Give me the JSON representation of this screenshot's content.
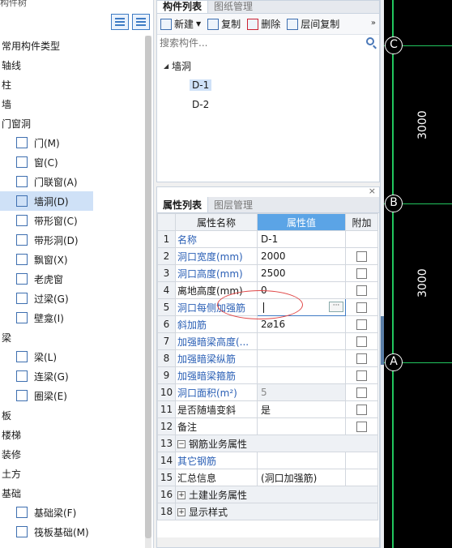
{
  "left_panel": {
    "title": "构件树",
    "tree": [
      {
        "label": "常用构件类型",
        "type": "cat"
      },
      {
        "label": "轴线",
        "type": "cat"
      },
      {
        "label": "柱",
        "type": "cat"
      },
      {
        "label": "墙",
        "type": "cat"
      },
      {
        "label": "门窗洞",
        "type": "cat"
      },
      {
        "label": "门(M)",
        "type": "leaf"
      },
      {
        "label": "窗(C)",
        "type": "leaf"
      },
      {
        "label": "门联窗(A)",
        "type": "leaf"
      },
      {
        "label": "墙洞(D)",
        "type": "leaf",
        "selected": true
      },
      {
        "label": "带形窗(C)",
        "type": "leaf"
      },
      {
        "label": "带形洞(D)",
        "type": "leaf"
      },
      {
        "label": "飘窗(X)",
        "type": "leaf"
      },
      {
        "label": "老虎窗",
        "type": "leaf"
      },
      {
        "label": "过梁(G)",
        "type": "leaf"
      },
      {
        "label": "壁龛(I)",
        "type": "leaf"
      },
      {
        "label": "梁",
        "type": "cat"
      },
      {
        "label": "梁(L)",
        "type": "leaf"
      },
      {
        "label": "连梁(G)",
        "type": "leaf"
      },
      {
        "label": "圈梁(E)",
        "type": "leaf"
      },
      {
        "label": "板",
        "type": "cat"
      },
      {
        "label": "楼梯",
        "type": "cat"
      },
      {
        "label": "装修",
        "type": "cat"
      },
      {
        "label": "土方",
        "type": "cat"
      },
      {
        "label": "基础",
        "type": "cat"
      },
      {
        "label": "基础梁(F)",
        "type": "leaf"
      },
      {
        "label": "筏板基础(M)",
        "type": "leaf"
      }
    ]
  },
  "component_panel": {
    "tabs": [
      "构件列表",
      "图纸管理"
    ],
    "toolbar": {
      "new": "新建",
      "copy": "复制",
      "delete": "删除",
      "floor_copy": "层间复制",
      "more": "»"
    },
    "search_placeholder": "搜索构件...",
    "tree_root": "墙洞",
    "items": [
      "D-1",
      "D-2"
    ],
    "selected": "D-1"
  },
  "property_panel": {
    "tabs": [
      "属性列表",
      "图层管理"
    ],
    "close": "×",
    "headers": {
      "name": "属性名称",
      "value": "属性值",
      "extra": "附加"
    },
    "rows": [
      {
        "num": "1",
        "name": "名称",
        "value": "D-1",
        "blue": true,
        "check": false
      },
      {
        "num": "2",
        "name": "洞口宽度(mm)",
        "value": "2000",
        "blue": true,
        "check": true
      },
      {
        "num": "3",
        "name": "洞口高度(mm)",
        "value": "2500",
        "blue": true,
        "check": true
      },
      {
        "num": "4",
        "name": "离地高度(mm)",
        "value": "0",
        "blue": false,
        "check": true
      },
      {
        "num": "5",
        "name": "洞口每侧加强筋",
        "value": "",
        "blue": true,
        "check": true,
        "editing": true
      },
      {
        "num": "6",
        "name": "斜加筋",
        "value": "2⌀16",
        "blue": true,
        "check": true
      },
      {
        "num": "7",
        "name": "加强暗梁高度(...",
        "value": "",
        "blue": true,
        "check": true
      },
      {
        "num": "8",
        "name": "加强暗梁纵筋",
        "value": "",
        "blue": true,
        "check": true
      },
      {
        "num": "9",
        "name": "加强暗梁箍筋",
        "value": "",
        "blue": true,
        "check": true
      },
      {
        "num": "10",
        "name": "洞口面积(m²)",
        "value": "5",
        "blue": true,
        "check": true,
        "grey": true
      },
      {
        "num": "11",
        "name": "是否随墙变斜",
        "value": "是",
        "blue": false,
        "check": true
      },
      {
        "num": "12",
        "name": "备注",
        "value": "",
        "blue": false,
        "check": true
      },
      {
        "num": "13",
        "name": "钢筋业务属性",
        "group": true,
        "toggle": "−"
      },
      {
        "num": "14",
        "name": "其它钢筋",
        "sub": true,
        "blue": true,
        "value": ""
      },
      {
        "num": "15",
        "name": "汇总信息",
        "sub": true,
        "blue": false,
        "value": "(洞口加强筋)"
      },
      {
        "num": "16",
        "name": "土建业务属性",
        "group": true,
        "toggle": "+"
      },
      {
        "num": "18",
        "name": "显示样式",
        "group": true,
        "toggle": "+"
      }
    ]
  },
  "canvas": {
    "axes": [
      "C",
      "B",
      "A"
    ],
    "dimensions": [
      "3000",
      "3000"
    ],
    "colors": {
      "axis": "#22c55e",
      "background": "#000000"
    }
  }
}
